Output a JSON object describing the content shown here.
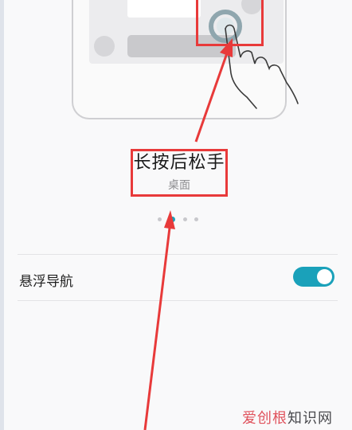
{
  "tutorial": {
    "title": "长按后松手",
    "subtitle": "桌面",
    "pager": {
      "count": 4,
      "active_index": 1
    }
  },
  "settings": {
    "floating_nav": {
      "label": "悬浮导航",
      "enabled": true
    }
  },
  "watermark": {
    "part_a": "爱创根",
    "part_b": "知识网"
  },
  "colors": {
    "accent": "#1aa1ba",
    "highlight": "#e83a3a",
    "background": "#f9f9fa"
  }
}
